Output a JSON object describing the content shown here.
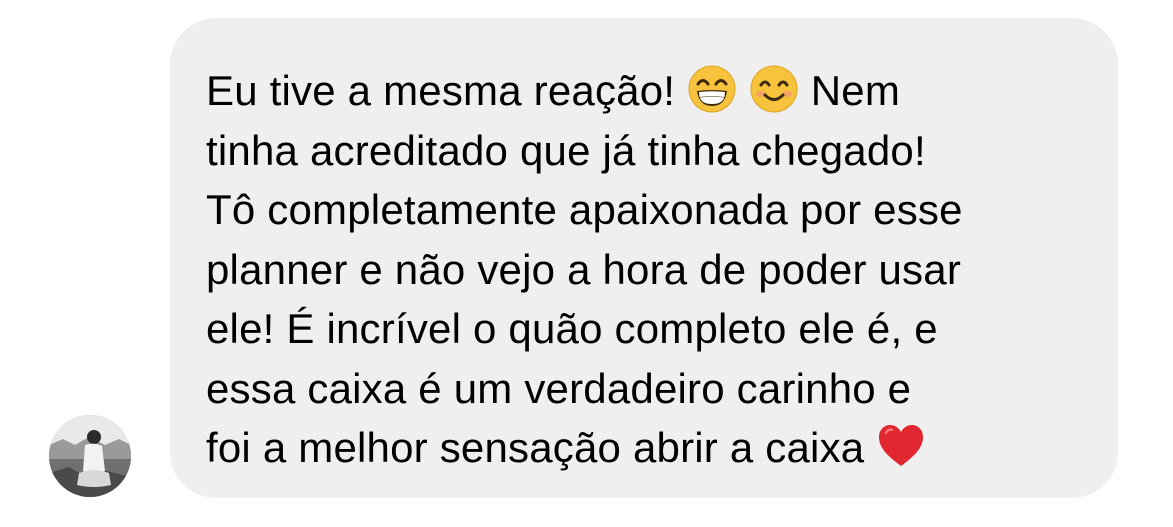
{
  "message": {
    "sender_avatar": "person-photo-avatar",
    "lines": [
      {
        "pre": "Eu tive a mesma reação!",
        "post": "Nem"
      },
      {
        "text": "tinha acreditado que já tinha chegado!"
      },
      {
        "text": "Tô completamente apaixonada por esse"
      },
      {
        "text": "planner e não vejo a hora de poder usar"
      },
      {
        "text": "ele! É incrível o quão completo ele é, e"
      },
      {
        "text": "essa caixa é um verdadeiro carinho e"
      },
      {
        "pre": "foi a melhor sensação abrir a caixa"
      }
    ],
    "emojis": {
      "grin": "grinning-face-with-smiling-eyes-emoji",
      "smile": "smiling-face-with-smiling-eyes-emoji",
      "heart": "red-heart-emoji"
    }
  },
  "colors": {
    "bubble_background": "#efefef",
    "text": "#000000",
    "page_background": "#ffffff",
    "heart": "#e0262f",
    "emoji_face": "#f7c23c"
  }
}
